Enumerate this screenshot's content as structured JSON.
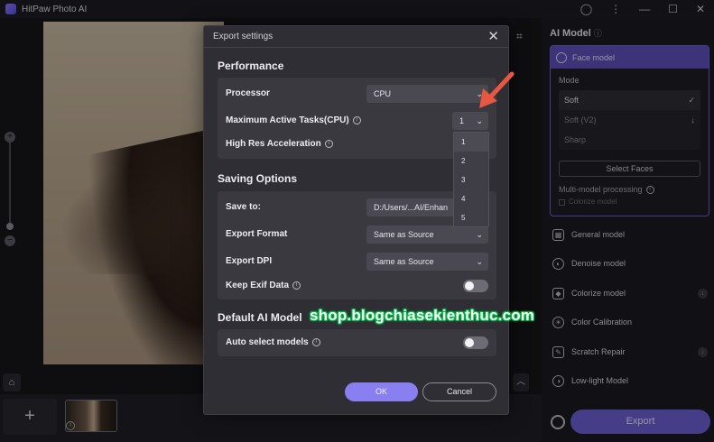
{
  "app": {
    "title": "HitPaw Photo AI"
  },
  "right_panel": {
    "title": "AI Model",
    "face_model": {
      "label": "Face model",
      "mode_label": "Mode",
      "modes": [
        {
          "label": "Soft",
          "active": true
        },
        {
          "label": "Soft (V2)",
          "active": false
        },
        {
          "label": "Sharp",
          "active": false
        }
      ],
      "select_faces": "Select Faces",
      "multi_label": "Multi-model processing",
      "colorize_label": "Colorize model"
    },
    "models": [
      {
        "label": "General model",
        "icon": "image-icon"
      },
      {
        "label": "Denoise model",
        "icon": "denoise-icon"
      },
      {
        "label": "Colorize model",
        "icon": "colorize-icon"
      },
      {
        "label": "Color Calibration",
        "icon": "color-calibration-icon"
      },
      {
        "label": "Scratch Repair",
        "icon": "scratch-repair-icon"
      },
      {
        "label": "Low-light Model",
        "icon": "low-light-icon"
      }
    ],
    "export_label": "Export"
  },
  "dialog": {
    "title": "Export settings",
    "close": "✕",
    "performance": {
      "title": "Performance",
      "processor_label": "Processor",
      "processor_value": "CPU",
      "tasks_label": "Maximum Active Tasks(CPU)",
      "tasks_value": "1",
      "tasks_options": [
        "1",
        "2",
        "3",
        "4",
        "5"
      ],
      "highres_label": "High Res Acceleration"
    },
    "saving": {
      "title": "Saving Options",
      "save_to_label": "Save to:",
      "save_to_value": "D:/Users/...AI/Enhan",
      "format_label": "Export Format",
      "format_value": "Same as Source",
      "dpi_label": "Export DPI",
      "dpi_value": "Same as Source",
      "exif_label": "Keep Exif Data"
    },
    "default_model": {
      "title": "Default AI Model",
      "auto_label": "Auto select models"
    },
    "ok": "OK",
    "cancel": "Cancel"
  },
  "watermark": "shop.blogchiasekienthuc.com",
  "colors": {
    "accent": "#6a5fcf",
    "ok": "#8a7ff0",
    "arrow": "#e8573f",
    "watermark_outline": "#00c84a"
  }
}
